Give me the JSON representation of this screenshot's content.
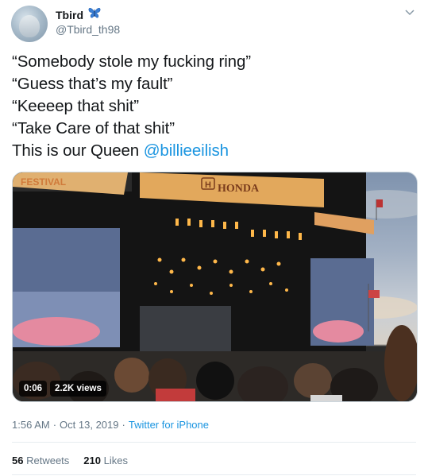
{
  "author": {
    "display_name": "Tbird",
    "handle": "@Tbird_th98",
    "badge_icon": "butterfly-icon"
  },
  "tweet": {
    "lines": [
      "“Somebody stole my fucking ring”",
      "“Guess that’s my fault”",
      "“Keeeep that shit”",
      "“Take Care of that shit”"
    ],
    "last_line_prefix": "This is our Queen ",
    "mention": "@billieeilish"
  },
  "video": {
    "duration": "0:06",
    "views": "2.2K views",
    "stage_banner": "HONDA",
    "festival_banner": "FESTIVAL"
  },
  "meta": {
    "time": "1:56 AM",
    "separator": "·",
    "date": "Oct 13, 2019",
    "source": "Twitter for iPhone"
  },
  "stats": {
    "retweets_count": "56",
    "retweets_label": "Retweets",
    "likes_count": "210",
    "likes_label": "Likes"
  },
  "colors": {
    "link": "#1b95e0",
    "secondary": "#657786",
    "text": "#14171a"
  }
}
